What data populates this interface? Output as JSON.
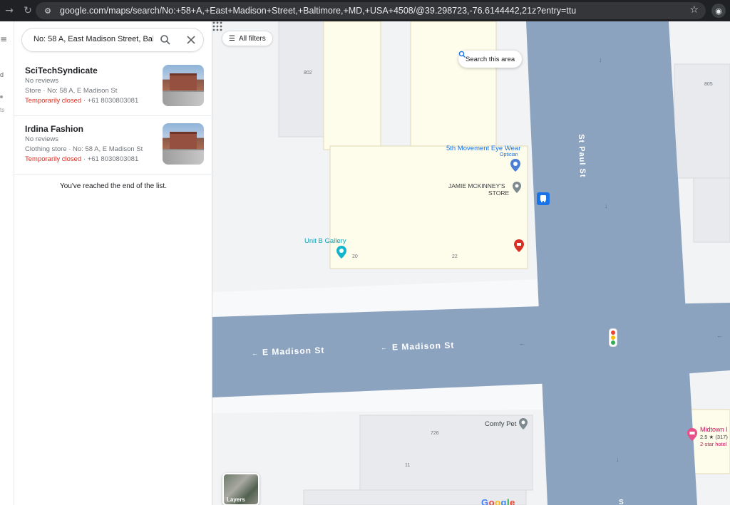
{
  "browser": {
    "back_icon": "→",
    "reload_icon": "↻",
    "url": "google.com/maps/search/No:+58+A,+East+Madison+Street,+Baltimore,+MD,+USA+4508/@39.298723,-76.6144442,21z?entry=ttu",
    "star_icon": "☆"
  },
  "rail": {
    "label1": "d",
    "label2": "ts"
  },
  "search": {
    "value": "No: 58 A, East Madison Street, Baltimore",
    "search_icon": "search-icon",
    "close_icon": "close-icon"
  },
  "results": [
    {
      "title": "SciTechSyndicate",
      "reviews": "No reviews",
      "category": "Store · No: 58 A, E Madison St",
      "status": "Temporarily closed",
      "phone": " · +61 8030803081"
    },
    {
      "title": "Irdina Fashion",
      "reviews": "No reviews",
      "category": "Clothing store · No: 58 A, E Madison St",
      "status": "Temporarily closed",
      "phone": " · +61 8030803081"
    }
  ],
  "end_of_list": "You've reached the end of the list.",
  "map": {
    "all_filters": "All filters",
    "search_this_area": "Search this area",
    "layers_label": "Layers",
    "streets": {
      "st_paul": "St Paul St",
      "madison_1": "E Madison St",
      "madison_2": "E Madison St",
      "st_paul_bottom": "S"
    },
    "places": {
      "eyewear_name": "5th Movement Eye Wear",
      "eyewear_type": "Optician",
      "jamie": "JAMIE MCKINNEY'S",
      "jamie_2": "STORE",
      "unit_b": "Unit B Gallery",
      "comfy_pet": "Comfy Pet",
      "midtown": "Midtown I",
      "midtown_rating": "2.5 ★ (317)",
      "midtown_class": "2-star hotel"
    },
    "numbers": {
      "n802": "802",
      "n805": "805",
      "n20": "20",
      "n22": "22",
      "n726": "726",
      "n11": "11"
    },
    "colors": {
      "road": "#8ca3bf",
      "block": "#fefcea",
      "building": "#e8eaed",
      "land": "#f1f3f4",
      "blue_pin": "#4a7fd6",
      "red_pin": "#d93025",
      "teal_pin": "#12b5cb",
      "hotel_pin": "#e8508a"
    }
  }
}
